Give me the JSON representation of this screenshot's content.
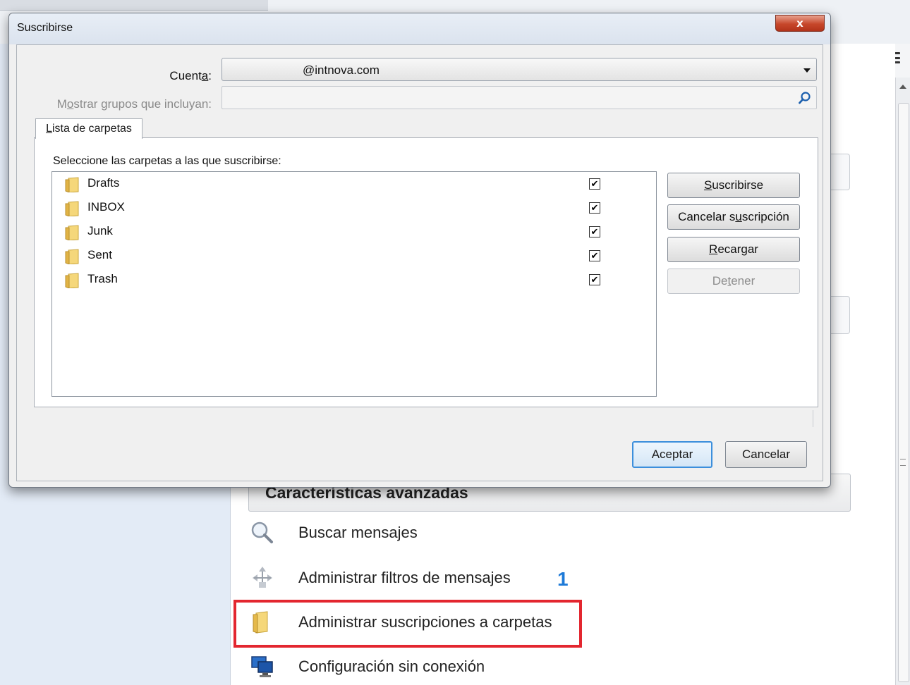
{
  "dialog": {
    "title": "Suscribirse",
    "close_label": "x",
    "account_label_pre": "Cuent",
    "account_label_key": "a",
    "account_label_post": ":",
    "account_value": "@intnova.com",
    "filter_label_pre": "M",
    "filter_label_key": "o",
    "filter_label_post": "strar grupos que incluyan:",
    "tab_label_key": "L",
    "tab_label_post": "ista de carpetas",
    "folders_heading": "Seleccione las carpetas a las que suscribirse:",
    "folders": [
      {
        "name": "Drafts",
        "checked": true
      },
      {
        "name": "INBOX",
        "checked": true
      },
      {
        "name": "Junk",
        "checked": true
      },
      {
        "name": "Sent",
        "checked": true
      },
      {
        "name": "Trash",
        "checked": true
      }
    ],
    "buttons": {
      "subscribe_key": "S",
      "subscribe_post": "uscribirse",
      "unsubscribe_pre": "Cancelar s",
      "unsubscribe_key": "u",
      "unsubscribe_post": "scripción",
      "reload_key": "R",
      "reload_post": "ecargar",
      "stop_pre": "De",
      "stop_key": "t",
      "stop_post": "ener",
      "accept": "Aceptar",
      "cancel": "Cancelar"
    }
  },
  "background": {
    "advanced_title": "Características avanzadas",
    "features": [
      {
        "label": "Buscar mensajes",
        "icon": "magnifier-icon"
      },
      {
        "label": "Administrar filtros de mensajes",
        "icon": "filter-arrows-icon"
      },
      {
        "label": "Administrar suscripciones a carpetas",
        "icon": "folder-icon"
      },
      {
        "label": "Configuración sin conexión",
        "icon": "offline-computer-icon"
      }
    ],
    "step_number": "1",
    "highlight_color": "#e3262f",
    "step_color": "#1e7ad8"
  }
}
